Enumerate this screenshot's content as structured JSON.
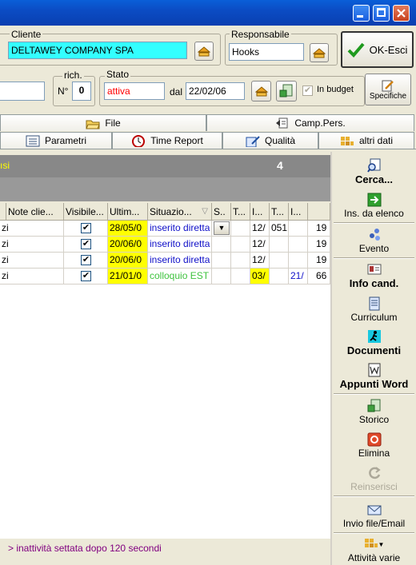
{
  "header": {
    "cliente_label": "Cliente",
    "cliente_value": "DELTAWEY COMPANY SPA",
    "responsabile_label": "Responsabile",
    "responsabile_value": "Hooks",
    "ok_button": "OK-Esci",
    "rich_label": "rich.",
    "n_label": "N°",
    "n_value": "0",
    "stato_label": "Stato",
    "stato_value": "attiva",
    "dal_label": "dal",
    "dal_value": "22/02/06",
    "in_budget_label": "In budget",
    "specifiche_label": "Specifiche"
  },
  "tabs_row1": [
    {
      "label": "File"
    },
    {
      "label": "Camp.Pers."
    }
  ],
  "tabs_row2": [
    {
      "label": "Parametri"
    },
    {
      "label": "Time Report"
    },
    {
      "label": "Qualità"
    },
    {
      "label": "altri dati"
    }
  ],
  "grid": {
    "bar_left_text": "ısi",
    "bar_count": "4",
    "columns": [
      "Note clie...",
      "Visibile...",
      "Ultim...",
      "Situazio...",
      "S..",
      "T...",
      "I...",
      "T...",
      "I..."
    ],
    "rows": [
      {
        "c0": "zi",
        "visible": true,
        "ultima": "28/05/0",
        "situazione": "inserito diretta",
        "i1": "12/",
        "t2": "051",
        "i2": "",
        "tail": "19"
      },
      {
        "c0": "zi",
        "visible": true,
        "ultima": "20/06/0",
        "situazione": "inserito diretta",
        "i1": "12/",
        "t2": "",
        "i2": "",
        "tail": "19"
      },
      {
        "c0": "zi",
        "visible": true,
        "ultima": "20/06/0",
        "situazione": "inserito diretta",
        "i1": "12/",
        "t2": "",
        "i2": "",
        "tail": "19"
      },
      {
        "c0": "zi",
        "visible": true,
        "ultima": "21/01/0",
        "situazione": "colloquio EST",
        "i1": "03/",
        "t2": "",
        "i2": "21/",
        "tail": "66"
      }
    ]
  },
  "right_panel": {
    "cerca": "Cerca...",
    "ins_elenco": "Ins. da elenco",
    "evento": "Evento",
    "info_cand": "Info cand.",
    "curriculum": "Curriculum",
    "documenti": "Documenti",
    "appunti_word": "Appunti Word",
    "storico": "Storico",
    "elimina": "Elimina",
    "reinserisci": "Reinserisci",
    "invio_file": "Invio file/Email",
    "attivita_varie": "Attività varie"
  },
  "status": {
    "text": "> inattività settata dopo 120 secondi"
  },
  "colors": {
    "cliente_bg": "#33ffff",
    "stato_text": "#ff0000",
    "highlight": "#ffff00",
    "link_blue": "#1010c8",
    "green": "#3fc33f",
    "status_text": "#800080"
  }
}
